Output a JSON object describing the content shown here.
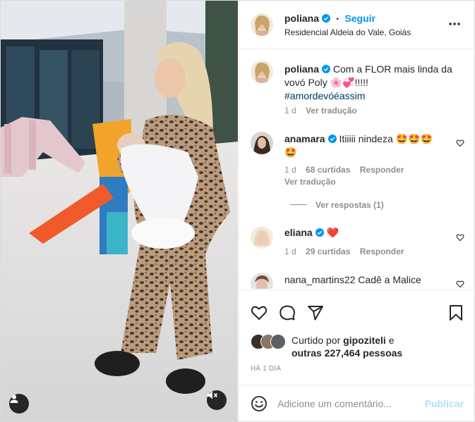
{
  "post": {
    "username": "poliana",
    "follow_label": "Seguir",
    "separator": "•",
    "location": "Residencial Aldeia do Vale, Goiás",
    "more_icon": "more-horizontal-icon"
  },
  "caption": {
    "username": "poliana",
    "text_line1": "Com a FLOR mais linda da",
    "text_line2": "vovó Poly",
    "text_suffix": "!!!!!",
    "emoji_flower": "🌸",
    "emoji_heart": "💞",
    "hashtag": "#amordevóéassim",
    "time": "1 d",
    "translate": "Ver tradução"
  },
  "comments": [
    {
      "username": "anamara",
      "text": "Itiiiii nindeza",
      "emojis_line1": "🤩🤩🤩",
      "emojis_line2": "🤩",
      "time": "1 d",
      "likes": "68 curtidas",
      "reply": "Responder",
      "translate": "Ver tradução",
      "view_replies": "Ver respostas (1)"
    },
    {
      "username": "eliana",
      "emoji": "❤️",
      "time": "1 d",
      "likes": "29 curtidas",
      "reply": "Responder"
    },
    {
      "username": "nana_martins22",
      "text": "Cadê a Malice"
    }
  ],
  "likes": {
    "prefix": "Curtido por",
    "user": "gipoziteli",
    "conj": "e",
    "others": "outras 227,464 pessoas"
  },
  "timestamp": "HÁ 1 DIA",
  "comment_box": {
    "placeholder": "Adicione um comentário...",
    "publish": "Publicar"
  },
  "colors": {
    "verified": "#0095f6",
    "follow": "#0095f6",
    "publish_disabled": "#b2dffc",
    "heart_red": "#ed4956"
  }
}
